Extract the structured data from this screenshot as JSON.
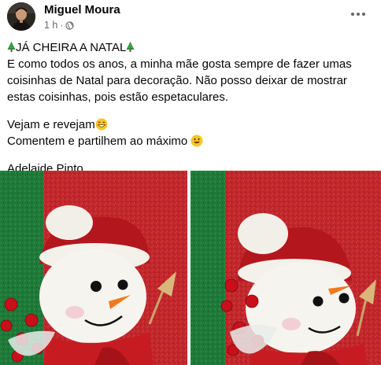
{
  "post": {
    "author": "Miguel Moura",
    "time": "1 h",
    "separator": "·",
    "privacy_icon": "globe-icon",
    "more_icon": "more-horizontal-icon",
    "text": {
      "title": "JÁ CHEIRA A NATAL",
      "line1": "E como todos os anos, a minha mãe gosta sempre de fazer umas coisinhas de Natal para decoração. Não posso deixar de mostrar estas coisinhas, pois estão espetaculares.",
      "line2": "Vejam e revejam",
      "line3": "Comentem e partilhem ao máximo",
      "line4": "Adelaide Pinto"
    },
    "emoji_icons": [
      "christmas-tree-icon",
      "grinning-emoji-icon",
      "smiling-emoji-icon"
    ],
    "photos": [
      {
        "name": "snowman-photo-1"
      },
      {
        "name": "snowman-photo-2"
      }
    ]
  },
  "colors": {
    "text": "#050505",
    "secondary": "#65676b",
    "glitter_red": "#c0262b",
    "glitter_green": "#1f7a3a"
  }
}
